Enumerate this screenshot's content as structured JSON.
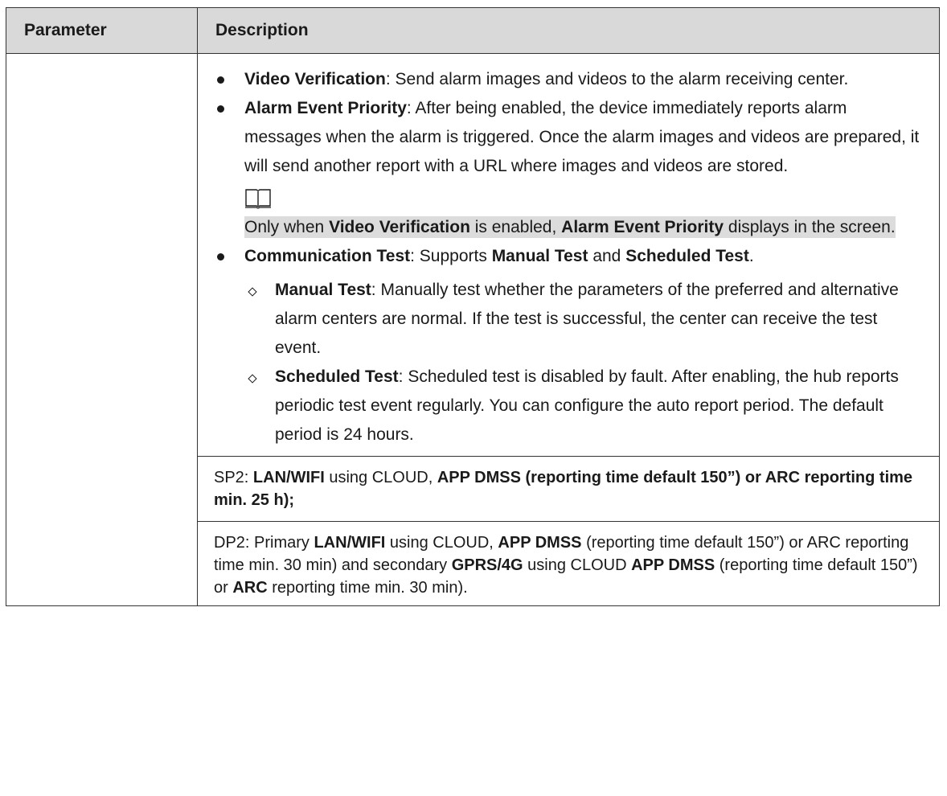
{
  "header": {
    "col1": "Parameter",
    "col2": "Description"
  },
  "items": {
    "video_verification": {
      "label": "Video Verification",
      "text": ": Send alarm images and videos to the alarm receiving center."
    },
    "alarm_event_priority": {
      "label": "Alarm Event Priority",
      "text": ": After being enabled, the device immediately reports alarm messages when the alarm is triggered. Once the alarm images and videos are prepared, it will send another report with a URL where images and videos are stored."
    },
    "note": {
      "icon": "book-icon",
      "t1": "Only when ",
      "b1": "Video Verification",
      "t2": " is enabled, ",
      "b2": "Alarm Event Priority",
      "t3": " displays in the screen."
    },
    "communication_test": {
      "label": "Communication Test",
      "t1": ": Supports ",
      "b1": "Manual Test",
      "t2": " and ",
      "b2": "Scheduled Test",
      "t3": "."
    },
    "manual_test": {
      "label": "Manual Test",
      "text": ": Manually test whether the parameters of the preferred and alternative alarm centers are normal. If the test is successful, the center can receive the test event."
    },
    "scheduled_test": {
      "label": "Scheduled Test",
      "text": ": Scheduled test is disabled by fault. After enabling, the hub reports periodic test event regularly. You can configure the auto report period. The default period is 24 hours."
    }
  },
  "sp2": {
    "t1": "SP2: ",
    "b1": "LAN/WIFI",
    "t2": " using CLOUD, ",
    "b2": "APP DMSS (reporting time default 150”) or ARC reporting time min. 25 h);"
  },
  "dp2": {
    "t1": "DP2: Primary ",
    "b1": "LAN/WIFI",
    "t2": " using CLOUD, ",
    "b2": "APP DMSS",
    "t3": " (reporting time default 150”) or ARC reporting time min. 30 min) and secondary ",
    "b3": "GPRS/4G",
    "t4": " using CLOUD ",
    "b4": "APP DMSS",
    "t5": " (reporting time default 150”) or ",
    "b5": "ARC",
    "t6": " reporting time min. 30 min)."
  }
}
